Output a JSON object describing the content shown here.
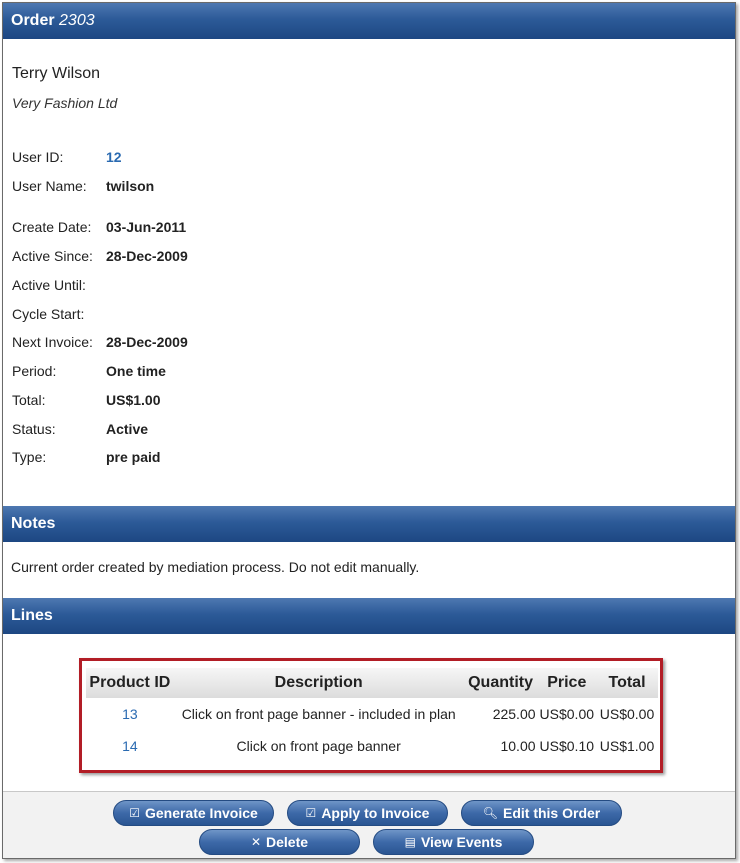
{
  "order": {
    "label": "Order",
    "number": "2303"
  },
  "customer": {
    "name": "Terry Wilson",
    "company": "Very Fashion Ltd"
  },
  "fields": [
    {
      "label": "User ID:",
      "value": "12"
    },
    {
      "label": "User Name:",
      "value": "twilson"
    },
    {
      "label": "Create Date:",
      "value": "03-Jun-2011"
    },
    {
      "label": "Active Since:",
      "value": "28-Dec-2009"
    },
    {
      "label": "Active Until:",
      "value": ""
    },
    {
      "label": "Cycle Start:",
      "value": ""
    },
    {
      "label": "Next Invoice:",
      "value": "28-Dec-2009"
    },
    {
      "label": "Period:",
      "value": "One time"
    },
    {
      "label": "Total:",
      "value": "US$1.00"
    },
    {
      "label": "Status:",
      "value": "Active"
    },
    {
      "label": "Type:",
      "value": "pre paid"
    }
  ],
  "notes": {
    "title": "Notes",
    "text": "Current order created by mediation process. Do not edit manually."
  },
  "lines": {
    "title": "Lines",
    "columns": [
      "Product ID",
      "Description",
      "Quantity",
      "Price",
      "Total"
    ],
    "rows": [
      {
        "product_id": "13",
        "description": "Click on front page banner - included in plan",
        "quantity": "225.00",
        "price": "US$0.00",
        "total": "US$0.00"
      },
      {
        "product_id": "14",
        "description": "Click on front page banner",
        "quantity": "10.00",
        "price": "US$0.10",
        "total": "US$1.00"
      }
    ]
  },
  "buttons": {
    "generate_invoice": {
      "label": "Generate Invoice",
      "icon": "checkbox-icon"
    },
    "apply_to_invoice": {
      "label": "Apply to Invoice",
      "icon": "checkbox-icon"
    },
    "edit_order": {
      "label": "Edit this Order",
      "icon": "search-icon"
    },
    "delete": {
      "label": "Delete",
      "icon": "close-icon"
    },
    "view_events": {
      "label": "View Events",
      "icon": "list-icon"
    }
  },
  "colors": {
    "header_blue": "#2c5a98",
    "highlight_red": "#b21d26",
    "link_blue": "#2a6ab1"
  }
}
